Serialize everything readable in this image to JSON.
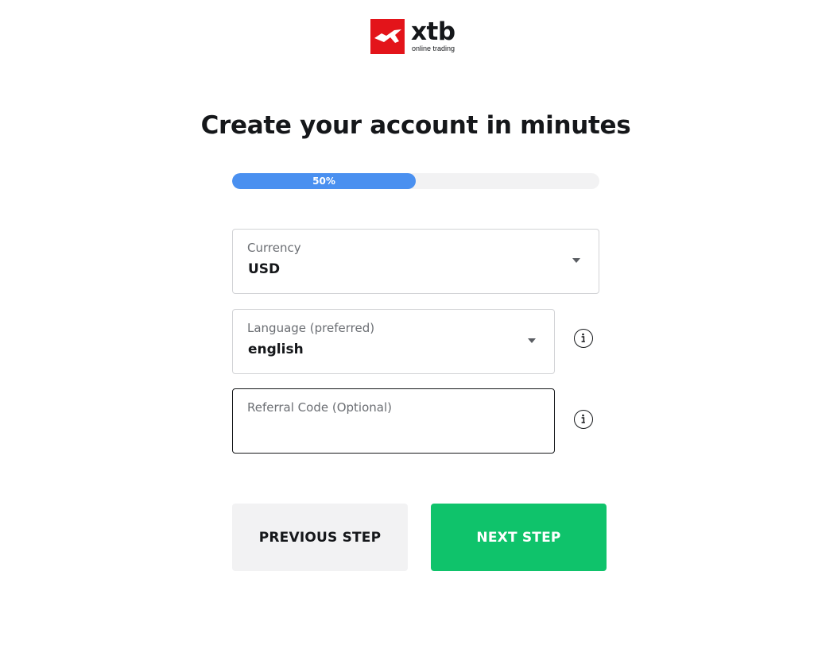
{
  "brand": {
    "name": "xtb",
    "tagline": "online trading",
    "accent_color": "#e3141a"
  },
  "page": {
    "title": "Create your account in minutes"
  },
  "progress": {
    "value_percent": 50,
    "label": "50%",
    "fill_color": "#4a90f0"
  },
  "form": {
    "currency": {
      "label": "Currency",
      "value": "USD",
      "icon": "chevron-down-icon"
    },
    "language": {
      "label": "Language (preferred)",
      "value": "english",
      "icon": "chevron-down-icon",
      "info_icon": "info-icon"
    },
    "referral": {
      "label": "Referral Code (Optional)",
      "value": "",
      "info_icon": "info-icon"
    }
  },
  "actions": {
    "previous_label": "PREVIOUS STEP",
    "next_label": "NEXT STEP",
    "next_color": "#0fc36b"
  }
}
